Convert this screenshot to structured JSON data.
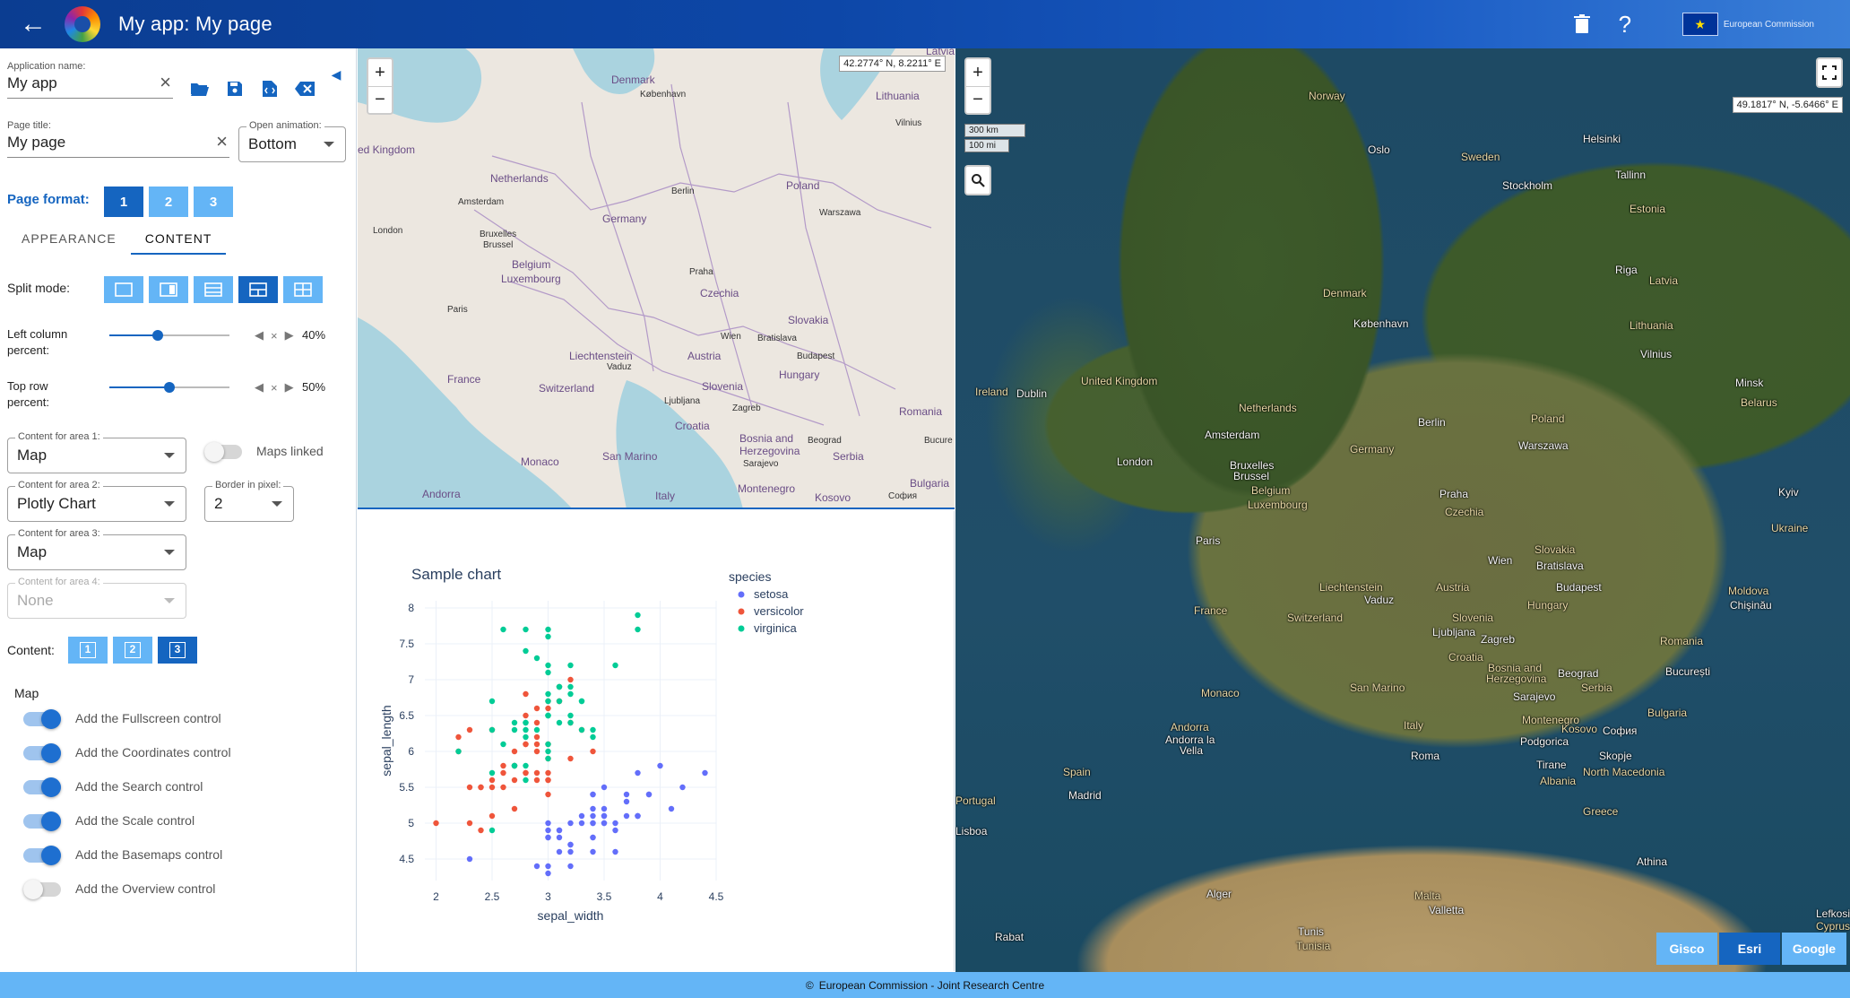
{
  "header": {
    "title": "My app:  My page",
    "back_icon": "arrow-left-icon",
    "logo_text": "European Commission"
  },
  "panel": {
    "app_name": {
      "label": "Application name:",
      "value": "My app"
    },
    "page_title": {
      "label": "Page title:",
      "value": "My page"
    },
    "open_animation": {
      "label": "Open animation:",
      "value": "Bottom"
    },
    "page_format": {
      "label": "Page format:",
      "options": [
        "1",
        "2",
        "3"
      ],
      "selected": "1"
    },
    "tabs": [
      {
        "label": "APPEARANCE"
      },
      {
        "label": "CONTENT"
      }
    ],
    "active_tab": "CONTENT",
    "split_mode": {
      "label": "Split mode:",
      "selected_index": 3
    },
    "left_column": {
      "label1": "Left column",
      "label2": "percent:",
      "value": "40%",
      "fraction": 0.4
    },
    "top_row": {
      "label1": "Top row",
      "label2": "percent:",
      "value": "50%",
      "fraction": 0.5
    },
    "content_area_1": {
      "label": "Content for area 1:",
      "value": "Map"
    },
    "maps_linked": {
      "label": "Maps linked",
      "on": false
    },
    "content_area_2": {
      "label": "Content for area 2:",
      "value": "Plotly Chart"
    },
    "border_pixel": {
      "label": "Border in pixel:",
      "value": "2"
    },
    "content_area_3": {
      "label": "Content for area 3:",
      "value": "Map"
    },
    "content_area_4": {
      "label": "Content for area 4:",
      "value": "None"
    },
    "content": {
      "label": "Content:",
      "options": [
        "1",
        "2",
        "3"
      ],
      "selected": "3"
    },
    "map_section": {
      "title": "Map",
      "controls": [
        {
          "label": "Add the Fullscreen control",
          "on": true
        },
        {
          "label": "Add the Coordinates control",
          "on": true
        },
        {
          "label": "Add the Search control",
          "on": true
        },
        {
          "label": "Add the Scale control",
          "on": true
        },
        {
          "label": "Add the Basemaps control",
          "on": true
        },
        {
          "label": "Add the Overview control",
          "on": false
        }
      ]
    }
  },
  "map1": {
    "coords": "42.2774° N, 8.2211° E",
    "zoom_in": "+",
    "zoom_out": "−",
    "labels": [
      "Denmark",
      "København",
      "Lithuania",
      "Vilnius",
      "ed Kingdom",
      "Netherlands",
      "Amsterdam",
      "Berlin",
      "Poland",
      "Germany",
      "Warszawa",
      "London",
      "Bruxelles",
      "Brussel",
      "Belgium",
      "Luxembourg",
      "Praha",
      "Czechia",
      "Paris",
      "Slovakia",
      "Wien",
      "Bratislava",
      "Budapest",
      "Liechtenstein",
      "Vaduz",
      "Austria",
      "Hungary",
      "France",
      "Switzerland",
      "Slovenia",
      "Ljubljana",
      "Zagreb",
      "Romania",
      "Croatia",
      "Bosnia and",
      "Herzegovina",
      "Beograd",
      "Serbia",
      "Sarajevo",
      "Monaco",
      "San Marino",
      "Andorra",
      "Italy",
      "Montenegro",
      "Kosovo",
      "София",
      "Bulgaria",
      "Bucure",
      "Latvia"
    ]
  },
  "chart_data": {
    "type": "scatter",
    "title": "Sample chart",
    "xlabel": "sepal_width",
    "ylabel": "sepal_length",
    "xlim": [
      1.9,
      4.5
    ],
    "ylim": [
      4.2,
      8.1
    ],
    "xticks": [
      "2",
      "2.5",
      "3",
      "3.5",
      "4",
      "4.5"
    ],
    "yticks": [
      "4.5",
      "5",
      "5.5",
      "6",
      "6.5",
      "7",
      "7.5",
      "8"
    ],
    "legend_title": "species",
    "legend_position": "right",
    "series": [
      {
        "name": "setosa",
        "color": "#636efa",
        "x": [
          3.5,
          3.0,
          3.2,
          3.1,
          3.6,
          3.9,
          3.4,
          3.4,
          2.9,
          3.1,
          3.7,
          3.4,
          3.0,
          3.0,
          4.0,
          4.4,
          3.9,
          3.5,
          3.8,
          3.8,
          3.4,
          3.7,
          3.6,
          3.3,
          3.4,
          3.0,
          3.4,
          3.5,
          3.4,
          3.2,
          3.1,
          3.4,
          4.1,
          4.2,
          3.1,
          3.2,
          3.5,
          3.6,
          3.0,
          3.4,
          3.5,
          2.3,
          3.2,
          3.5,
          3.8,
          3.0,
          3.8,
          3.2,
          3.7,
          3.3
        ],
        "y": [
          5.1,
          4.9,
          4.7,
          4.6,
          5.0,
          5.4,
          4.6,
          5.0,
          4.4,
          4.9,
          5.4,
          4.8,
          4.8,
          4.3,
          5.8,
          5.7,
          5.4,
          5.1,
          5.7,
          5.1,
          5.4,
          5.1,
          4.6,
          5.1,
          4.8,
          5.0,
          5.0,
          5.2,
          5.2,
          4.7,
          4.8,
          5.4,
          5.2,
          5.5,
          4.9,
          5.0,
          5.5,
          4.9,
          4.4,
          5.1,
          5.0,
          4.5,
          4.4,
          5.0,
          5.1,
          4.8,
          5.1,
          4.6,
          5.3,
          5.0
        ]
      },
      {
        "name": "versicolor",
        "color": "#ef553b",
        "x": [
          3.2,
          3.2,
          3.1,
          2.3,
          2.8,
          2.8,
          3.3,
          2.4,
          2.9,
          2.7,
          2.0,
          3.0,
          2.2,
          2.9,
          2.9,
          3.1,
          3.0,
          2.7,
          2.2,
          2.5,
          3.2,
          2.8,
          2.5,
          2.8,
          2.9,
          3.0,
          2.8,
          3.0,
          2.9,
          2.6,
          2.4,
          2.4,
          2.7,
          2.7,
          3.0,
          3.4,
          3.1,
          2.3,
          3.0,
          2.5,
          2.6,
          3.0,
          2.6,
          2.3,
          2.7,
          3.0,
          2.9,
          2.9,
          2.5,
          2.8
        ],
        "y": [
          7.0,
          6.4,
          6.9,
          5.5,
          6.5,
          5.7,
          6.3,
          4.9,
          6.6,
          5.2,
          5.0,
          5.9,
          6.0,
          6.1,
          5.6,
          6.7,
          5.6,
          5.8,
          6.2,
          5.6,
          5.9,
          6.1,
          6.3,
          6.1,
          6.4,
          6.6,
          6.8,
          6.7,
          6.0,
          5.7,
          5.5,
          5.5,
          5.8,
          6.0,
          5.4,
          6.0,
          6.7,
          6.3,
          5.6,
          5.5,
          5.5,
          6.1,
          5.8,
          5.0,
          5.6,
          5.7,
          5.7,
          6.2,
          5.1,
          5.7
        ]
      },
      {
        "name": "virginica",
        "color": "#00cc96",
        "x": [
          3.3,
          2.7,
          3.0,
          2.9,
          3.0,
          3.0,
          2.5,
          2.9,
          2.5,
          3.6,
          3.2,
          2.7,
          3.0,
          2.5,
          2.8,
          3.2,
          3.0,
          3.8,
          2.6,
          2.2,
          3.2,
          2.8,
          2.8,
          2.7,
          3.3,
          3.2,
          2.8,
          3.0,
          2.8,
          3.0,
          2.8,
          3.8,
          2.8,
          2.8,
          2.6,
          3.0,
          3.4,
          3.1,
          3.0,
          3.1,
          3.1,
          3.1,
          2.7,
          3.2,
          3.3,
          3.0,
          2.5,
          3.0,
          3.4,
          3.0
        ],
        "y": [
          6.3,
          5.8,
          7.1,
          6.3,
          6.5,
          7.6,
          4.9,
          7.3,
          6.7,
          7.2,
          6.5,
          6.4,
          6.8,
          5.7,
          5.8,
          6.4,
          6.5,
          7.7,
          7.7,
          6.0,
          6.9,
          5.6,
          7.7,
          6.3,
          6.7,
          7.2,
          6.2,
          6.1,
          6.4,
          7.2,
          7.4,
          7.9,
          6.4,
          6.3,
          6.1,
          7.7,
          6.3,
          6.4,
          6.0,
          6.9,
          6.7,
          6.9,
          5.8,
          6.8,
          6.7,
          6.7,
          6.3,
          6.5,
          6.2,
          5.9
        ]
      }
    ]
  },
  "map2": {
    "coords": "49.1817° N, -5.6466° E",
    "scale_km": "300 km",
    "scale_mi": "100 mi",
    "basemaps": [
      {
        "label": "Gisco"
      },
      {
        "label": "Esri"
      },
      {
        "label": "Google"
      }
    ],
    "active_basemap": "Esri",
    "labels": [
      "Norway",
      "Oslo",
      "Sweden",
      "Helsinki",
      "Stockholm",
      "Tallinn",
      "Estonia",
      "Riga",
      "Latvia",
      "Denmark",
      "København",
      "Lithuania",
      "Vilnius",
      "Minsk",
      "Belarus",
      "Ireland",
      "Dublin",
      "United Kingdom",
      "Netherlands",
      "Amsterdam",
      "Berlin",
      "Poland",
      "Warszawa",
      "London",
      "Germany",
      "Bruxelles",
      "Brussel",
      "Belgium",
      "Luxembourg",
      "Praha",
      "Czechia",
      "Kyiv",
      "Ukraine",
      "Paris",
      "Slovakia",
      "Wien",
      "Bratislava",
      "Budapest",
      "Moldova",
      "Chişinău",
      "Liechtenstein",
      "Vaduz",
      "Austria",
      "Hungary",
      "France",
      "Switzerland",
      "Slovenia",
      "Ljubljana",
      "Zagreb",
      "Romania",
      "Croatia",
      "Bosnia and",
      "Herzegovina",
      "Beograd",
      "Serbia",
      "București",
      "Monaco",
      "San Marino",
      "Sarajevo",
      "Andorra",
      "Andorra la",
      "Vella",
      "Montenegro",
      "Kosovo",
      "София",
      "Bulgaria",
      "Italy",
      "Podgorica",
      "Tirane",
      "Skopje",
      "Roma",
      "North Macedonia",
      "Albania",
      "Spain",
      "Portugal",
      "Madrid",
      "Greece",
      "Lisboa",
      "Athina",
      "Alger",
      "Malta",
      "Valletta",
      "Tunis",
      "Tunisia",
      "Rabat",
      "Lefkosia",
      "Cyprus"
    ],
    "fullscreen_icon": "fullscreen-icon",
    "search_icon": "search-icon"
  },
  "footer": {
    "text": "European Commission - Joint Research Centre",
    "icon": "copyright-icon"
  },
  "colors": {
    "accent": "#1565c0",
    "accent_light": "#64b5f6",
    "header": "#0d47a8"
  }
}
